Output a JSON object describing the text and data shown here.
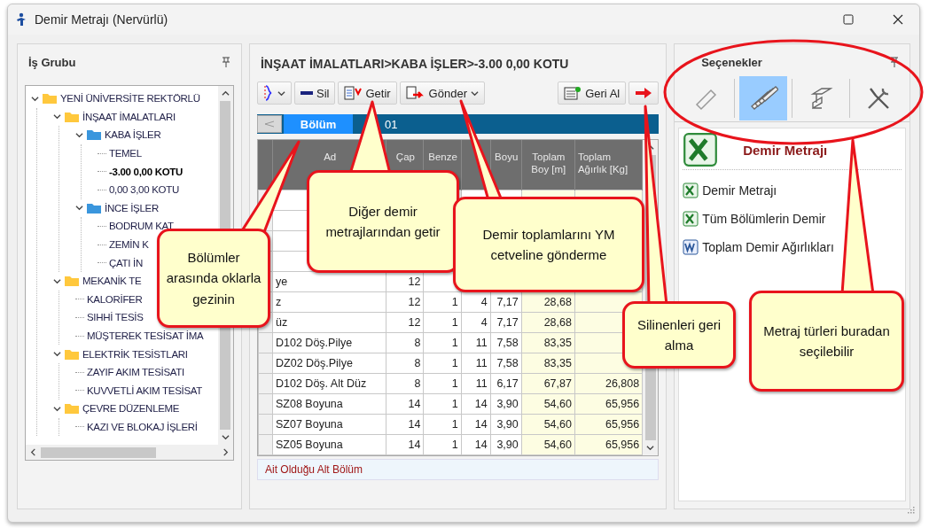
{
  "window": {
    "title": "Demir Metrajı (Nervürlü)"
  },
  "left_panel": {
    "title": "İş Grubu",
    "tree": [
      {
        "label": "YENİ ÜNİVERSİTE REKTÖRLÜ",
        "kind": "folder",
        "color": "#ffc83d",
        "expanded": true,
        "selected": false,
        "children": [
          {
            "label": "İNŞAAT İMALATLARI",
            "kind": "folder",
            "color": "#ffc83d",
            "expanded": true,
            "selected": false,
            "children": [
              {
                "label": "KABA İŞLER",
                "kind": "folder",
                "color": "#3a96dd",
                "expanded": true,
                "selected": false,
                "children": [
                  {
                    "label": "TEMEL",
                    "kind": "leaf",
                    "selected": false
                  },
                  {
                    "label": "-3.00  0,00 KOTU",
                    "kind": "leaf",
                    "selected": true
                  },
                  {
                    "label": "0,00  3,00 KOTU",
                    "kind": "leaf",
                    "selected": false
                  }
                ]
              },
              {
                "label": "İNCE İŞLER",
                "kind": "folder",
                "color": "#3a96dd",
                "expanded": true,
                "selected": false,
                "children": [
                  {
                    "label": "BODRUM KAT",
                    "kind": "leaf",
                    "selected": false
                  },
                  {
                    "label": "ZEMİN K",
                    "kind": "leaf",
                    "selected": false
                  },
                  {
                    "label": "ÇATI İN",
                    "kind": "leaf",
                    "selected": false
                  }
                ]
              }
            ]
          },
          {
            "label": "MEKANİK TE",
            "kind": "folder",
            "color": "#ffc83d",
            "expanded": true,
            "selected": false,
            "children": [
              {
                "label": "KALORİFER",
                "kind": "leaf",
                "selected": false
              },
              {
                "label": "SIHHİ TESİS",
                "kind": "leaf",
                "selected": false
              },
              {
                "label": "MÜŞTEREK TESİSAT İMA",
                "kind": "leaf",
                "selected": false
              }
            ]
          },
          {
            "label": "ELEKTRİK TESİSTLARI",
            "kind": "folder",
            "color": "#ffc83d",
            "expanded": true,
            "selected": false,
            "children": [
              {
                "label": "ZAYIF AKIM TESİSATI",
                "kind": "leaf",
                "selected": false
              },
              {
                "label": "KUVVETLİ AKIM TESİSAT",
                "kind": "leaf",
                "selected": false
              }
            ]
          },
          {
            "label": "ÇEVRE DÜZENLEME",
            "kind": "folder",
            "color": "#ffc83d",
            "expanded": true,
            "selected": false,
            "children": [
              {
                "label": "KAZI VE BLOKAJ İŞLERİ",
                "kind": "leaf",
                "selected": false
              }
            ]
          }
        ]
      }
    ]
  },
  "middle_panel": {
    "title": "İNŞAAT İMALATLARI>KABA İŞLER>-3.00  0,00 KOTU",
    "toolbar": [
      {
        "kind": "brace",
        "dropdown": true
      },
      {
        "kind": "delete",
        "label": "Sil",
        "dropdown": false
      },
      {
        "kind": "fetch",
        "label": "Getir",
        "dropdown": false
      },
      {
        "kind": "send",
        "label": "Gönder",
        "dropdown": true
      },
      {
        "kind": "undo",
        "label": "Geri Al",
        "dropdown": false
      },
      {
        "kind": "next",
        "dropdown": false
      }
    ],
    "tabs": [
      {
        "label": "Bölüm",
        "selected": true
      },
      {
        "label": "01",
        "selected": false
      }
    ],
    "table": {
      "columns": [
        {
          "label": "Ad"
        },
        {
          "label": "Çap"
        },
        {
          "label": "Benze"
        },
        {},
        {
          "label": "Boyu"
        },
        {
          "label": "Toplam Boy [m]"
        },
        {
          "label": "Toplam Ağırlık [Kg]"
        }
      ],
      "rows": [
        {
          "cells": [
            "ye",
            "12",
            null,
            null,
            null,
            null,
            null
          ]
        },
        {
          "cells": [
            "z",
            "12",
            "1",
            "4",
            "7,17",
            "28,68",
            null
          ]
        },
        {
          "cells": [
            "üz",
            "12",
            "1",
            "4",
            "7,17",
            "28,68",
            null
          ]
        },
        {
          "cells": [
            "D102 Döş.Pilye",
            "8",
            "1",
            "11",
            "7,58",
            "83,35",
            null
          ]
        },
        {
          "cells": [
            "DZ02 Döş.Pilye",
            "8",
            "1",
            "11",
            "7,58",
            "83,35",
            null
          ]
        },
        {
          "cells": [
            "D102 Döş. Alt Düz",
            "8",
            "1",
            "11",
            "6,17",
            "67,87",
            "26,808"
          ]
        },
        {
          "cells": [
            "SZ08 Boyuna",
            "14",
            "1",
            "14",
            "3,90",
            "54,60",
            "65,956"
          ]
        },
        {
          "cells": [
            "SZ07 Boyuna",
            "14",
            "1",
            "14",
            "3,90",
            "54,60",
            "65,956"
          ]
        },
        {
          "cells": [
            "SZ05 Boyuna",
            "14",
            "1",
            "14",
            "3,90",
            "54,60",
            "65,956"
          ]
        }
      ]
    },
    "status": "Ait Olduğu Alt Bölüm"
  },
  "right_panel": {
    "title": "Seçenekler",
    "modes": [
      {
        "kind": "ruler",
        "selected": false
      },
      {
        "kind": "rebar",
        "selected": true
      },
      {
        "kind": "steel",
        "selected": false
      },
      {
        "kind": "tools",
        "selected": false
      }
    ],
    "report_title": "Demir Metrajı",
    "reports": [
      {
        "kind": "excel",
        "label": "Demir Metrajı"
      },
      {
        "kind": "excel",
        "label": "Tüm Bölümlerin Demir"
      },
      {
        "kind": "word",
        "label": "Toplam Demir Ağırlıkları"
      }
    ]
  },
  "callouts": [
    {
      "text": "Bölümler arasında oklarla gezinin"
    },
    {
      "text": "Diğer demir metrajlarından getir"
    },
    {
      "text": "Demir toplamlarını YM cetveline gönderme"
    },
    {
      "text": "Silinenleri geri alma"
    },
    {
      "text": "Metraj türleri buradan seçilebilir"
    }
  ]
}
